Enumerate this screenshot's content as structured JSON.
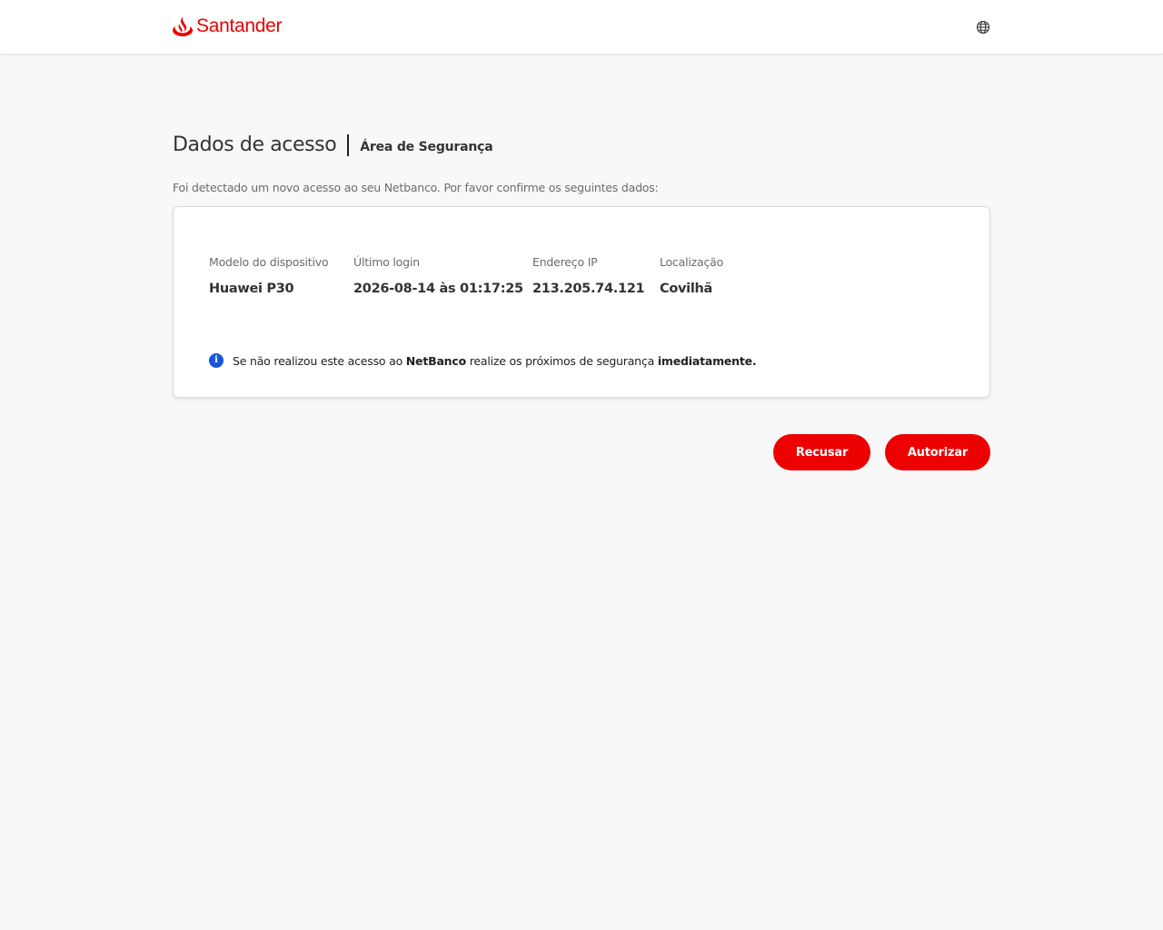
{
  "header": {
    "brand": "Santander",
    "brand_color": "#ec0000",
    "logo_icon": "santander-flame-icon",
    "language_icon": "globe-icon"
  },
  "page": {
    "title": "Dados de acesso",
    "subtitle": "Área de Segurança",
    "intro": "Foi detectado um novo acesso ao seu Netbanco. Por favor confirme os seguintes dados:"
  },
  "access": {
    "fields": [
      {
        "label": "Modelo do dispositivo",
        "value": "Huawei P30"
      },
      {
        "label": "Último login",
        "value": "2026-08-14 às 01:17:25"
      },
      {
        "label": "Endereço IP",
        "value": "213.205.74.121"
      },
      {
        "label": "Localização",
        "value": "Covilhã"
      }
    ]
  },
  "notice": {
    "icon": "info-icon",
    "icon_color": "#1a56db",
    "part1": "Se não realizou este acesso ao ",
    "bold1": "NetBanco",
    "part2": " realize os próximos de segurança ",
    "bold2": "imediatamente."
  },
  "actions": {
    "refuse_label": "Recusar",
    "authorize_label": "Autorizar"
  }
}
